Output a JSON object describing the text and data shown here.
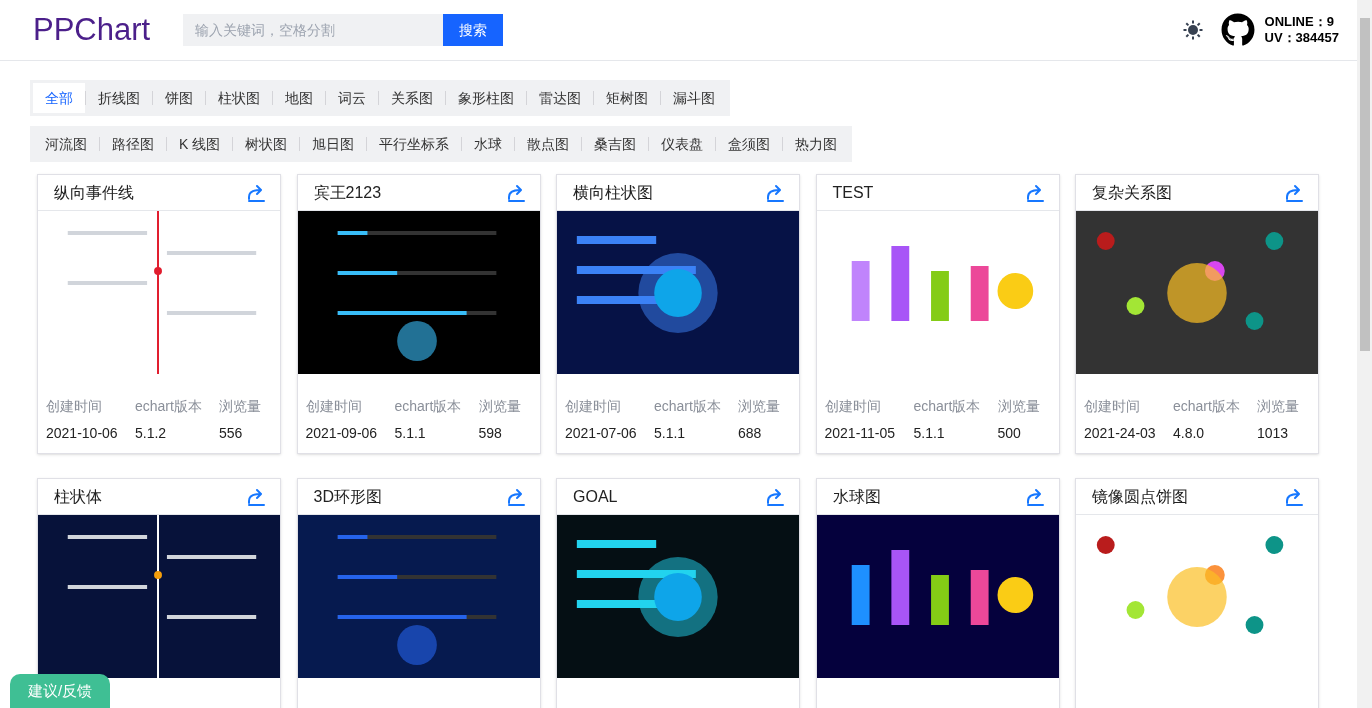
{
  "header": {
    "logo": "PPChart",
    "search": {
      "placeholder": "输入关键词，空格分割",
      "button": "搜索"
    },
    "online": "ONLINE：9",
    "uv": "UV：384457"
  },
  "tab_rows": [
    [
      {
        "label": "全部",
        "selected": true
      },
      {
        "label": "折线图",
        "selected": false
      },
      {
        "label": "饼图",
        "selected": false
      },
      {
        "label": "柱状图",
        "selected": false
      },
      {
        "label": "地图",
        "selected": false
      },
      {
        "label": "词云",
        "selected": false
      },
      {
        "label": "关系图",
        "selected": false
      },
      {
        "label": "象形柱图",
        "selected": false
      },
      {
        "label": "雷达图",
        "selected": false
      },
      {
        "label": "矩树图",
        "selected": false
      },
      {
        "label": "漏斗图",
        "selected": false
      }
    ],
    [
      {
        "label": "河流图",
        "selected": false
      },
      {
        "label": "路径图",
        "selected": false
      },
      {
        "label": "K 线图",
        "selected": false
      },
      {
        "label": "树状图",
        "selected": false
      },
      {
        "label": "旭日图",
        "selected": false
      },
      {
        "label": "平行坐标系",
        "selected": false
      },
      {
        "label": "水球",
        "selected": false
      },
      {
        "label": "散点图",
        "selected": false
      },
      {
        "label": "桑吉图",
        "selected": false
      },
      {
        "label": "仪表盘",
        "selected": false
      },
      {
        "label": "盒须图",
        "selected": false
      },
      {
        "label": "热力图",
        "selected": false
      }
    ]
  ],
  "cards": [
    {
      "title": "纵向事件线",
      "labels": [
        "创建时间",
        "echart版本",
        "浏览量"
      ],
      "values": [
        "2021-10-06",
        "5.1.2",
        "556"
      ]
    },
    {
      "title": "宾王2123",
      "labels": [
        "创建时间",
        "echart版本",
        "浏览量"
      ],
      "values": [
        "2021-09-06",
        "5.1.1",
        "598"
      ]
    },
    {
      "title": "横向柱状图",
      "labels": [
        "创建时间",
        "echart版本",
        "浏览量"
      ],
      "values": [
        "2021-07-06",
        "5.1.1",
        "688"
      ]
    },
    {
      "title": "TEST",
      "labels": [
        "创建时间",
        "echart版本",
        "浏览量"
      ],
      "values": [
        "2021-11-05",
        "5.1.1",
        "500"
      ]
    },
    {
      "title": "复杂关系图",
      "labels": [
        "创建时间",
        "echart版本",
        "浏览量"
      ],
      "values": [
        "2021-24-03",
        "4.8.0",
        "1013"
      ]
    },
    {
      "title": "柱状体"
    },
    {
      "title": "3D环形图"
    },
    {
      "title": "GOAL"
    },
    {
      "title": "水球图"
    },
    {
      "title": "镜像圆点饼图"
    }
  ],
  "feedback_button": "建议/反馈"
}
